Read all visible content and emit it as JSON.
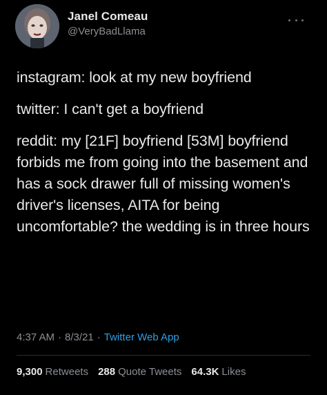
{
  "author": {
    "display_name": "Janel Comeau",
    "handle": "@VeryBadLlama",
    "avatar_icon": "profile-photo"
  },
  "more_icon": "more-horizontal-icon",
  "tweet": {
    "paragraphs": [
      "instagram: look at my new boyfriend",
      "twitter: I can't get a boyfriend",
      "reddit: my [21F] boyfriend [53M] boyfriend forbids me from going into the basement and has a sock drawer full of missing women's driver's licenses, AITA for being uncomfortable? the wedding is in three hours"
    ]
  },
  "meta": {
    "time": "4:37 AM",
    "separator": "·",
    "date": "8/3/21",
    "app": "Twitter Web App"
  },
  "stats": {
    "retweets_count": "9,300",
    "retweets_label": "Retweets",
    "quotes_count": "288",
    "quotes_label": "Quote Tweets",
    "likes_count": "64.3K",
    "likes_label": "Likes"
  },
  "colors": {
    "background": "#000000",
    "text": "#e7e9ea",
    "secondary": "#8b8f94",
    "link": "#2f9fe8"
  }
}
